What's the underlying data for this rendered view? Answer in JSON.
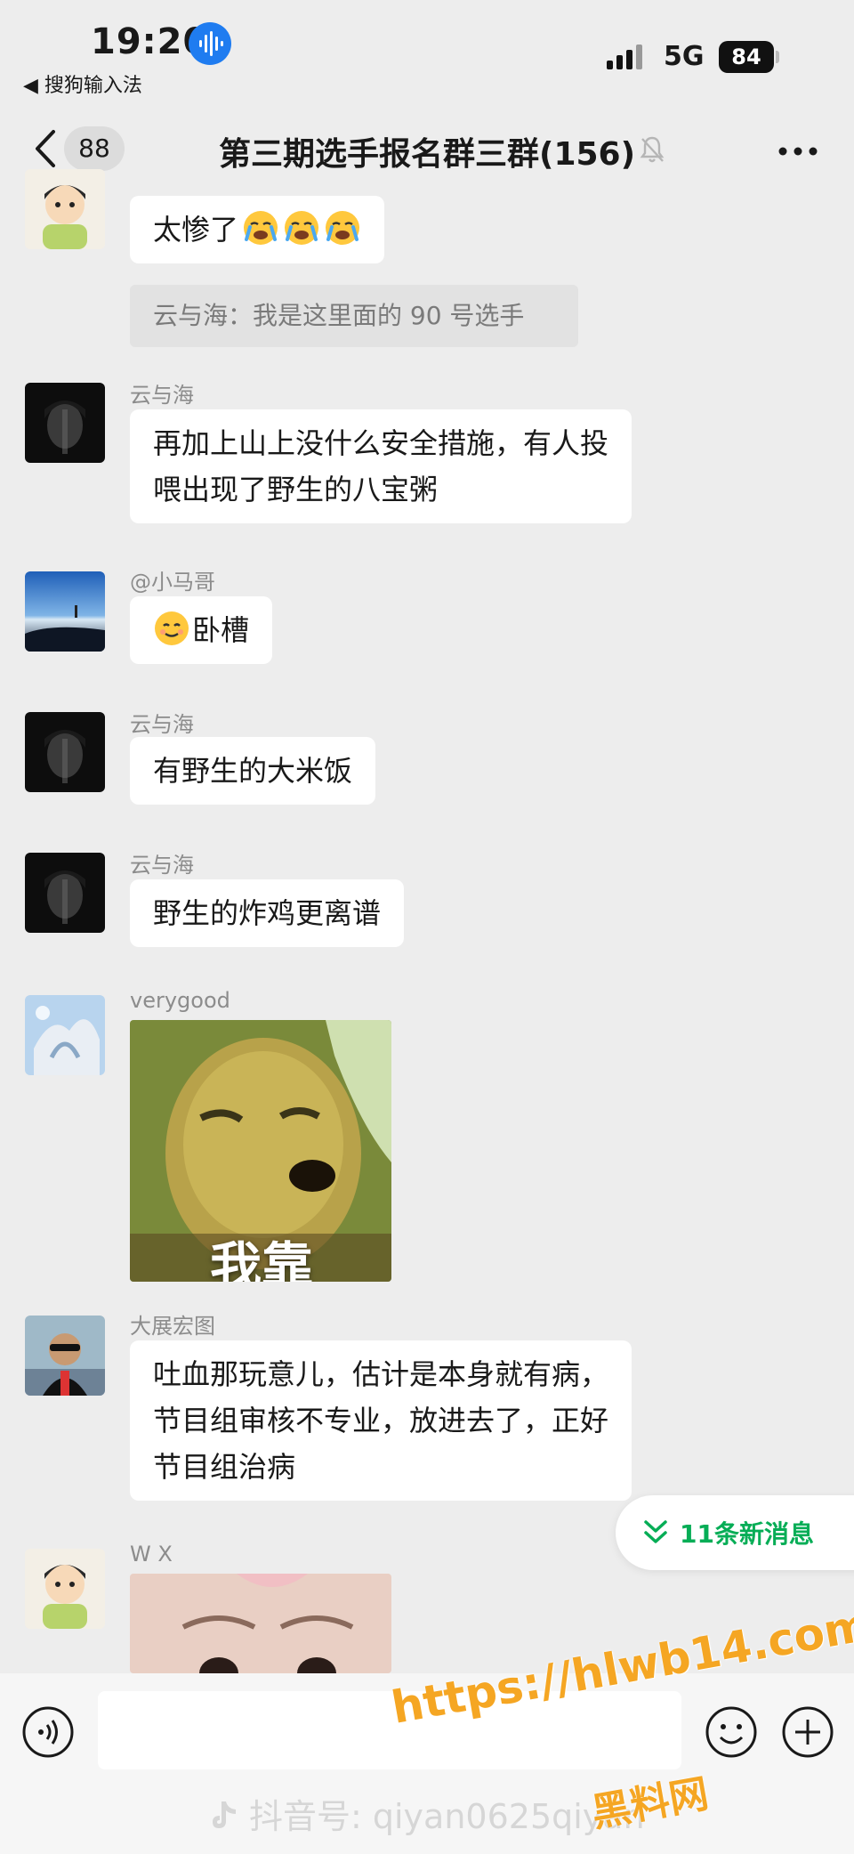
{
  "status_bar": {
    "time": "19:20",
    "back_app": "◀ 搜狗输入法",
    "network": "5G",
    "battery": "84"
  },
  "nav": {
    "unread": "88",
    "title": "第三期选手报名群三群(156)"
  },
  "messages": {
    "m1": {
      "text": "太惨了"
    },
    "system": "云与海：我是这里面的 90 号选手",
    "m2": {
      "sender": "云与海",
      "line1": "再加上山上没什么安全措施，有人投",
      "line2": "喂出现了野生的八宝粥"
    },
    "m3": {
      "sender": "@小马哥",
      "text": "卧槽"
    },
    "m4": {
      "sender": "云与海",
      "text": "有野生的大米饭"
    },
    "m5": {
      "sender": "云与海",
      "text": "野生的炸鸡更离谱"
    },
    "m6": {
      "sender": "verygood",
      "sticker_caption": "我靠"
    },
    "m7": {
      "sender": "大展宏图",
      "line1": "吐血那玩意儿，估计是本身就有病，",
      "line2": "节目组审核不专业，放进去了，正好",
      "line3": "节目组治病"
    },
    "m8": {
      "sender": "W  X"
    }
  },
  "new_messages_pill": "11条新消息",
  "watermark": {
    "douyin": "抖音号: qiyan0625qiyan",
    "url": "https://hlwb14.com",
    "name": "黑料网"
  },
  "colors": {
    "background": "#ededed",
    "bubble": "#ffffff",
    "accent_green": "#06ad56",
    "watermark_orange": "#f5a623"
  },
  "icons": [
    "voice-input-icon",
    "back-arrow-icon",
    "mute-icon",
    "more-icon",
    "chevron-double-down-icon",
    "voice-button-icon",
    "emoji-icon",
    "plus-icon",
    "douyin-logo-icon"
  ]
}
